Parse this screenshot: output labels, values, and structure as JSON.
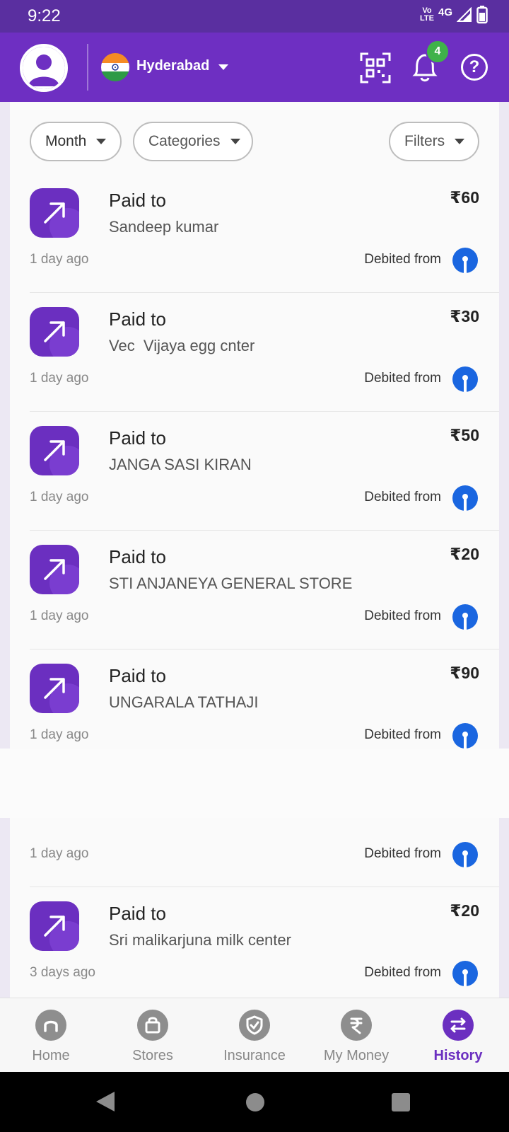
{
  "status_bar": {
    "time": "9:22",
    "volte_top": "Vo",
    "volte_bottom": "LTE",
    "network": "4G"
  },
  "header": {
    "city": "Hyderabad",
    "notification_count": "4",
    "help_label": "?",
    "colors": {
      "brand": "#6e2fc2",
      "badge": "#3fb24a"
    }
  },
  "filters": {
    "month": "Month",
    "categories": "Categories",
    "filters": "Filters"
  },
  "transactions": [
    {
      "type": "Paid to",
      "name": "Sandeep kumar",
      "amount": "₹60",
      "time": "1 day ago",
      "debit": "Debited from"
    },
    {
      "type": "Paid to",
      "name": "Vec  Vijaya egg cnter",
      "amount": "₹30",
      "time": "1 day ago",
      "debit": "Debited from"
    },
    {
      "type": "Paid to",
      "name": "JANGA SASI KIRAN",
      "amount": "₹50",
      "time": "1 day ago",
      "debit": "Debited from"
    },
    {
      "type": "Paid to",
      "name": "STI ANJANEYA GENERAL STORE",
      "amount": "₹20",
      "time": "1 day ago",
      "debit": "Debited from"
    },
    {
      "type": "Paid to",
      "name": "UNGARALA TATHAJI",
      "amount": "₹90",
      "time": "1 day ago",
      "debit": "Debited from"
    },
    {
      "time": "1 day ago",
      "debit": "Debited from"
    },
    {
      "type": "Paid to",
      "name": "Sri malikarjuna milk center",
      "amount": "₹20",
      "time": "3 days ago",
      "debit": "Debited from"
    }
  ],
  "bottom_nav": [
    {
      "label": "Home",
      "icon": "home-icon"
    },
    {
      "label": "Stores",
      "icon": "bag-icon"
    },
    {
      "label": "Insurance",
      "icon": "shield-icon"
    },
    {
      "label": "My Money",
      "icon": "rupee-icon"
    },
    {
      "label": "History",
      "icon": "transfer-icon",
      "active": true
    }
  ]
}
